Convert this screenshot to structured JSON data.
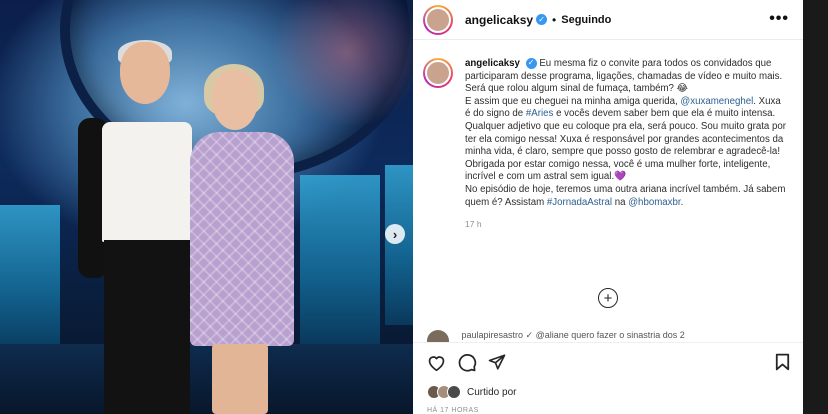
{
  "photo": {
    "next_icon": "chevron-right-icon",
    "next_glyph": "›"
  },
  "header": {
    "username": "angelicaksy",
    "verified_icon": "verified-badge-icon",
    "separator": "•",
    "follow_state": "Seguindo",
    "more_icon": "more-options-icon",
    "more_glyph": "•••"
  },
  "caption": {
    "username": "angelicaksy",
    "text_1": "Eu mesma fiz o convite para todos os convidados que participaram desse programa, ligações, chamadas de vídeo e muito mais. Será que rolou algum sinal de fumaça, também? 😂",
    "text_2": "E assim que eu cheguei na minha amiga querida,",
    "mention_1": "@xuxameneghel",
    "text_3": ". Xuxa é do signo de",
    "hashtag_1": "#Aries",
    "text_4": "e vocês devem saber bem que ela é muito intensa. Qualquer adjetivo que eu coloque pra ela, será pouco. Sou muito grata por ter ela comigo nessa! Xuxa é responsável por grandes acontecimentos da minha vida, é claro, sempre que posso gosto de relembrar e agradecê-la! Obrigada por estar comigo nessa, você é uma mulher forte, inteligente, incrível e com um astral sem igual.💜",
    "text_5": "No episódio de hoje, teremos uma outra ariana incrível também. Já sabem quem é? Assistam",
    "hashtag_2": "#JornadaAstral",
    "text_6": "na",
    "mention_2": "@hbomaxbr",
    "text_7": ".",
    "timestamp": "17 h"
  },
  "comments": {
    "add_icon": "add-circle-icon",
    "add_glyph": "+",
    "partial_comment": "paulapiresastro   ✓  @aliane quero fazer o sinastria dos 2"
  },
  "actions": {
    "like_icon": "heart-icon",
    "comment_icon": "comment-icon",
    "share_icon": "share-icon",
    "save_icon": "bookmark-icon",
    "liked_by": "Curtido por",
    "time_ago": "HÁ 17 HORAS"
  },
  "colors": {
    "verified": "#3897f0",
    "link": "#2b5f8f",
    "meta": "#8e8e8e"
  }
}
